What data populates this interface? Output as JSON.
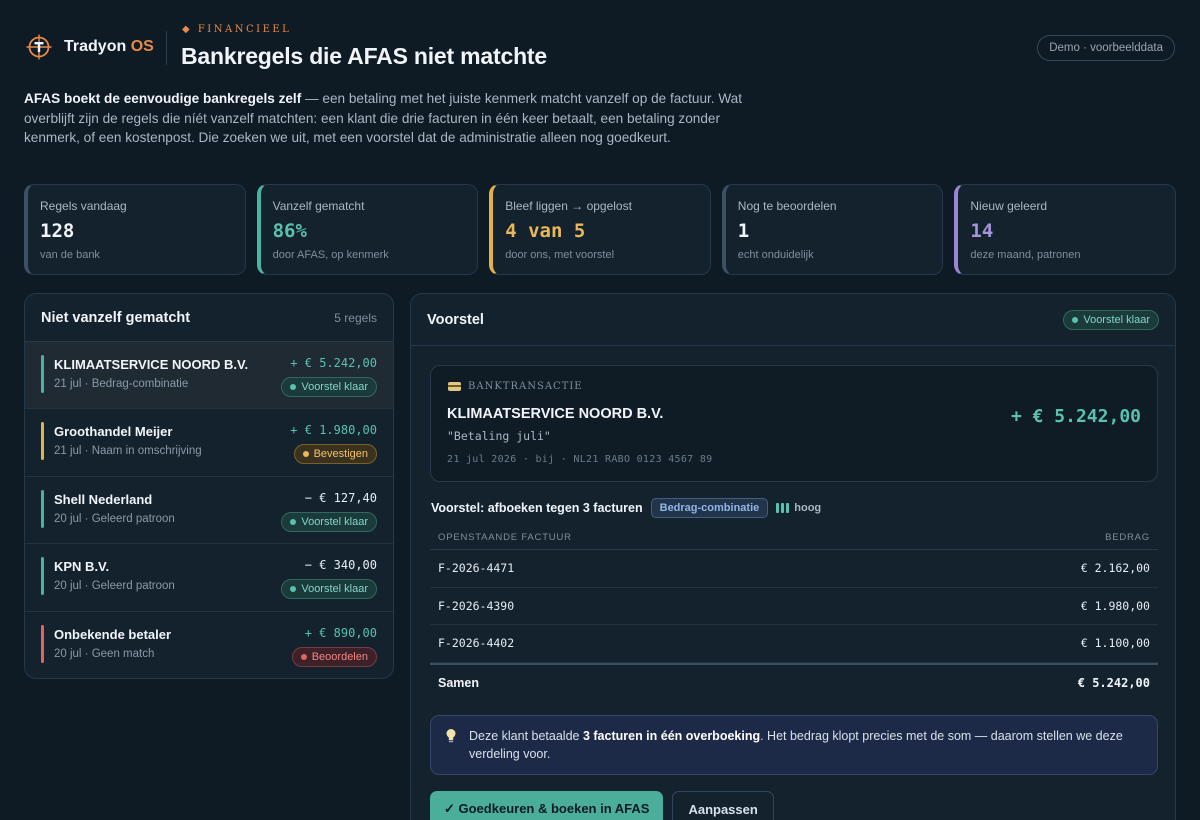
{
  "brand": {
    "name": "Tradyon",
    "suffix": "OS"
  },
  "header": {
    "eyebrow": "◆ FINANCIEEL",
    "title": "Bankregels die AFAS niet matchte",
    "demo_badge": "Demo · voorbeelddata"
  },
  "intro": {
    "bold": "AFAS boekt de eenvoudige bankregels zelf",
    "rest": " — een betaling met het juiste kenmerk matcht vanzelf op de factuur. Wat overblijft zijn de regels die níét vanzelf matchten: een klant die drie facturen in één keer betaalt, een betaling zonder kenmerk, of een kostenpost. Die zoeken we uit, met een voorstel dat de administratie alleen nog goedkeurt."
  },
  "stats": [
    {
      "label": "Regels vandaag",
      "value": "128",
      "sub": "van de bank",
      "accent": "neutral"
    },
    {
      "label": "Vanzelf gematcht",
      "value": "86%",
      "sub": "door AFAS, op kenmerk",
      "accent": "teal"
    },
    {
      "label": "Bleef liggen → opgelost",
      "value": "4 van 5",
      "sub": "door ons, met voorstel",
      "accent": "amber"
    },
    {
      "label": "Nog te beoordelen",
      "value": "1",
      "sub": "echt onduidelijk",
      "accent": "neutral"
    },
    {
      "label": "Nieuw geleerd",
      "value": "14",
      "sub": "deze maand, patronen",
      "accent": "purple"
    }
  ],
  "unmatched": {
    "title": "Niet vanzelf gematcht",
    "count": "5 regels",
    "rows": [
      {
        "name": "KLIMAATSERVICE NOORD B.V.",
        "meta": "21 jul · Bedrag-combinatie",
        "amount": "+ € 5.242,00",
        "badge": "Voorstel klaar",
        "status": "teal"
      },
      {
        "name": "Groothandel Meijer",
        "meta": "21 jul · Naam in omschrijving",
        "amount": "+ € 1.980,00",
        "badge": "Bevestigen",
        "status": "amber"
      },
      {
        "name": "Shell Nederland",
        "meta": "20 jul · Geleerd patroon",
        "amount": "− € 127,40",
        "badge": "Voorstel klaar",
        "status": "teal"
      },
      {
        "name": "KPN B.V.",
        "meta": "20 jul · Geleerd patroon",
        "amount": "− € 340,00",
        "badge": "Voorstel klaar",
        "status": "teal"
      },
      {
        "name": "Onbekende betaler",
        "meta": "20 jul · Geen match",
        "amount": "+ € 890,00",
        "badge": "Beoordelen",
        "status": "red"
      }
    ]
  },
  "voorstel": {
    "title": "Voorstel",
    "status": "Voorstel klaar",
    "transaction": {
      "label": "BANKTRANSACTIE",
      "name": "KLIMAATSERVICE NOORD B.V.",
      "description": "\"Betaling juli\"",
      "bank_line": "21 jul 2026 · bij · NL21 RABO 0123 4567 89",
      "amount": "+ € 5.242,00"
    },
    "proposal_title": "Voorstel: afboeken tegen 3 facturen",
    "tag": "Bedrag-combinatie",
    "confidence": "hoog",
    "table": {
      "col_invoice": "OPENSTAANDE FACTUUR",
      "col_amount": "BEDRAG",
      "rows": [
        {
          "invoice": "F-2026-4471",
          "amount": "€ 2.162,00"
        },
        {
          "invoice": "F-2026-4390",
          "amount": "€ 1.980,00"
        },
        {
          "invoice": "F-2026-4402",
          "amount": "€ 1.100,00"
        }
      ],
      "total_label": "Samen",
      "total_amount": "€ 5.242,00"
    },
    "note": {
      "pre": "Deze klant betaalde ",
      "bold": "3 facturen in één overboeking",
      "post": ". Het bedrag klopt precies met de som — daarom stellen we deze verdeling voor."
    },
    "approve_label": "✓ Goedkeuren & boeken in AFAS",
    "adjust_label": "Aanpassen"
  },
  "colors": {
    "background": "#0e1a24",
    "accent_orange": "#e88a48",
    "teal": "#58c2ae",
    "amber": "#e9b85a",
    "red": "#e46262",
    "purple": "#a594dc"
  }
}
